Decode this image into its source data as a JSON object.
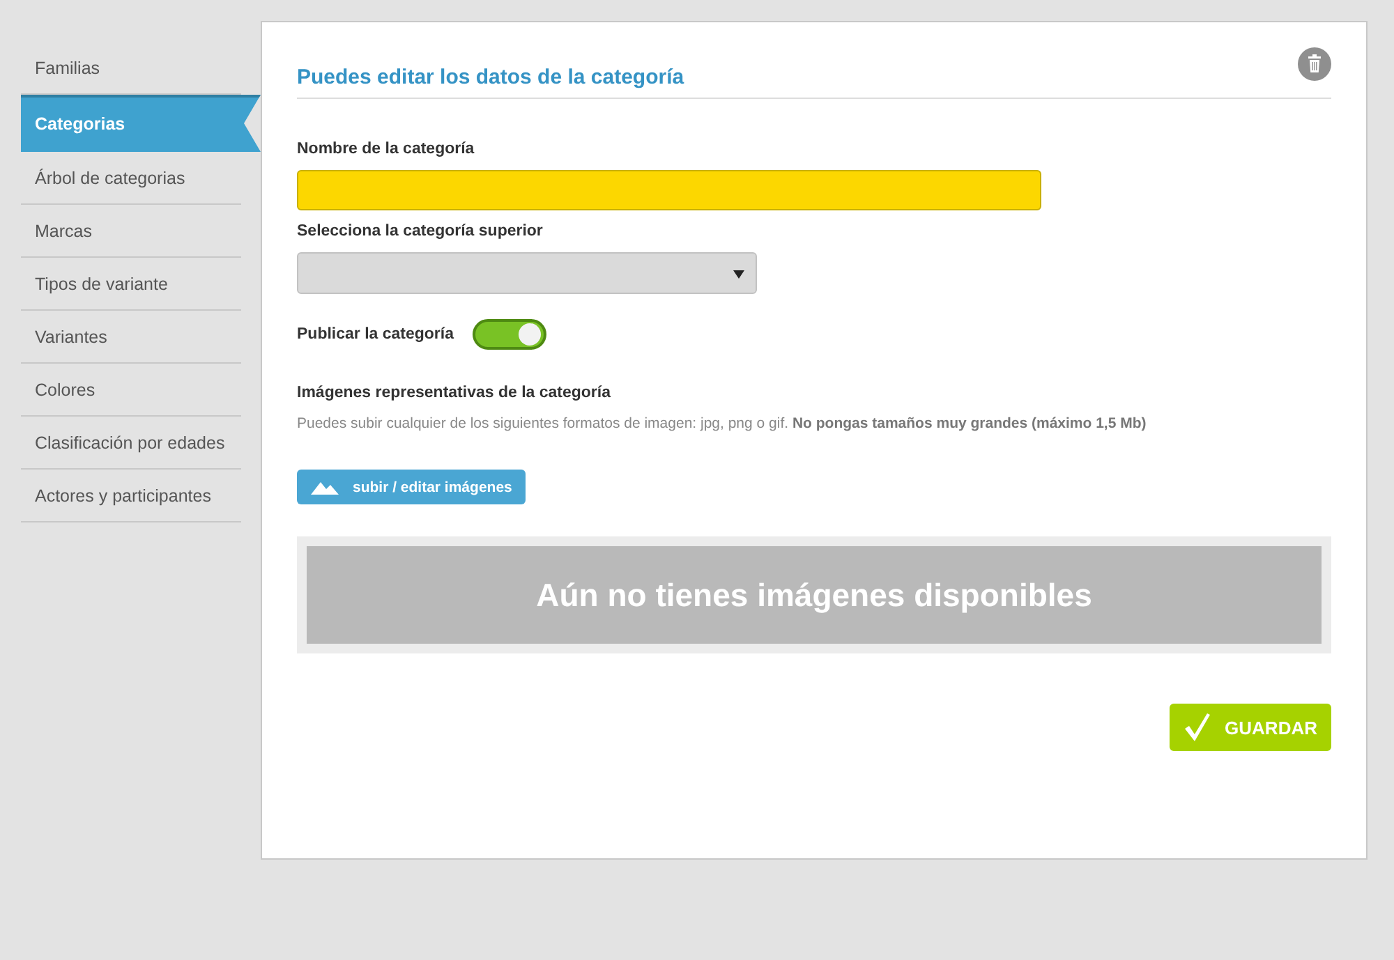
{
  "sidebar": {
    "items": [
      {
        "label": "Familias",
        "selected": false
      },
      {
        "label": "Categorias",
        "selected": true
      },
      {
        "label": "Árbol de categorias",
        "selected": false
      },
      {
        "label": "Marcas",
        "selected": false
      },
      {
        "label": "Tipos de variante",
        "selected": false
      },
      {
        "label": "Variantes",
        "selected": false
      },
      {
        "label": "Colores",
        "selected": false
      },
      {
        "label": "Clasificación por edades",
        "selected": false
      },
      {
        "label": "Actores y participantes",
        "selected": false
      }
    ]
  },
  "form": {
    "title": "Puedes editar los datos de la categoría",
    "name_label": "Nombre de la categoría",
    "parent_label": "Selecciona la categoría superior",
    "publish_label": "Publicar la categoría",
    "publish_on": true,
    "images_label": "Imágenes representativas de la categoría",
    "images_hint": "Puedes subir cualquier de los siguientes formatos de imagen: jpg, png o gif. **No pongas tamaños muy grandes (máximo 1,5 Mb)**",
    "upload_button": "subir / editar imágenes",
    "empty_message": "Aún no tienes imágenes disponibles",
    "save_button": "GUARDAR"
  }
}
